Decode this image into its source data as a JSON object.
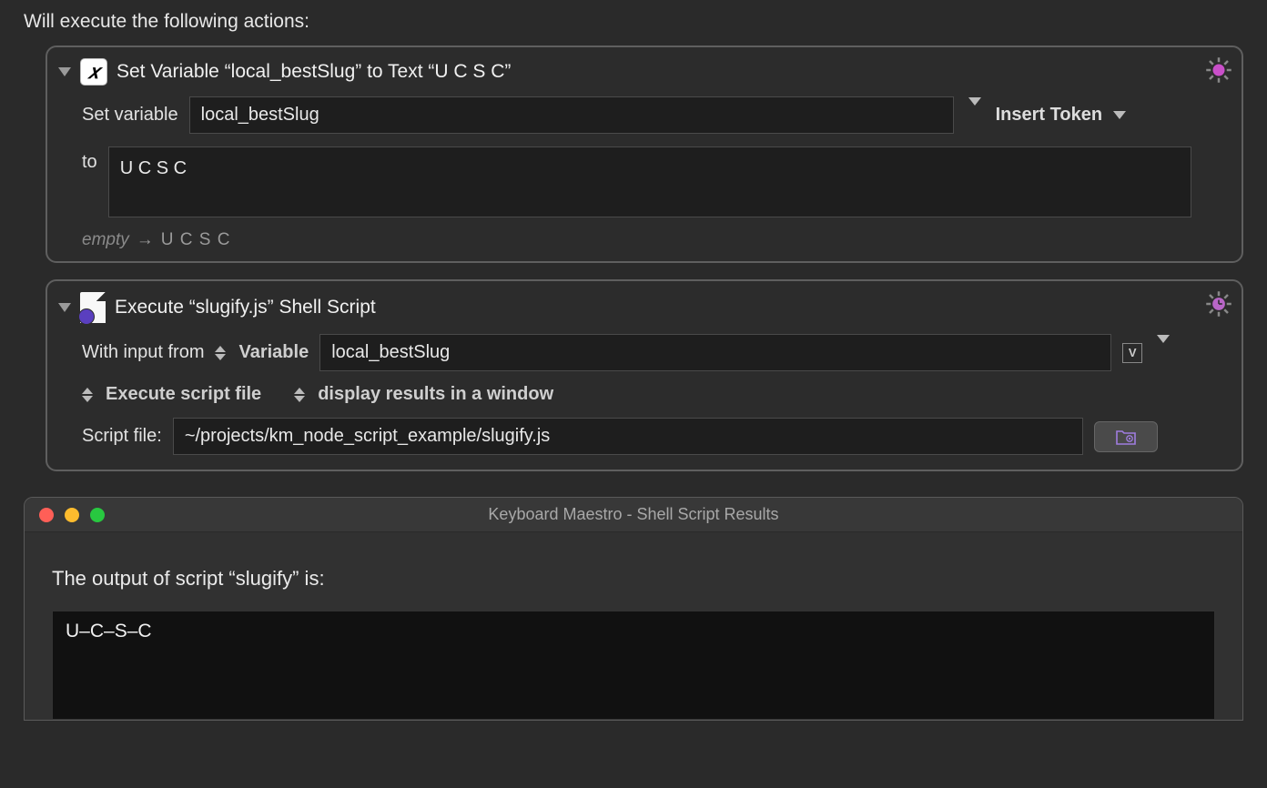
{
  "header": "Will execute the following actions:",
  "action1": {
    "title": "Set Variable “local_bestSlug” to Text “U C S C”",
    "setVarLabel": "Set variable",
    "varName": "local_bestSlug",
    "insertToken": "Insert Token",
    "toLabel": "to",
    "toValue": "U C S C",
    "preview": {
      "empty": "empty",
      "arrow": "→",
      "value": "U C S C"
    },
    "gearColor": "#c94fc9"
  },
  "action2": {
    "title": "Execute “slugify.js” Shell Script",
    "withInputFromLabel": "With input from",
    "variablePopup": "Variable",
    "inputVarName": "local_bestSlug",
    "badge": "V",
    "executePopup": "Execute script file",
    "displayPopup": "display results in a window",
    "scriptFileLabel": "Script file:",
    "scriptFilePath": "~/projects/km_node_script_example/slugify.js",
    "gearColor": "#b866c6"
  },
  "resultsWindow": {
    "title": "Keyboard Maestro - Shell Script Results",
    "heading": "The output of script “slugify” is:",
    "output": "U–C–S–C"
  }
}
